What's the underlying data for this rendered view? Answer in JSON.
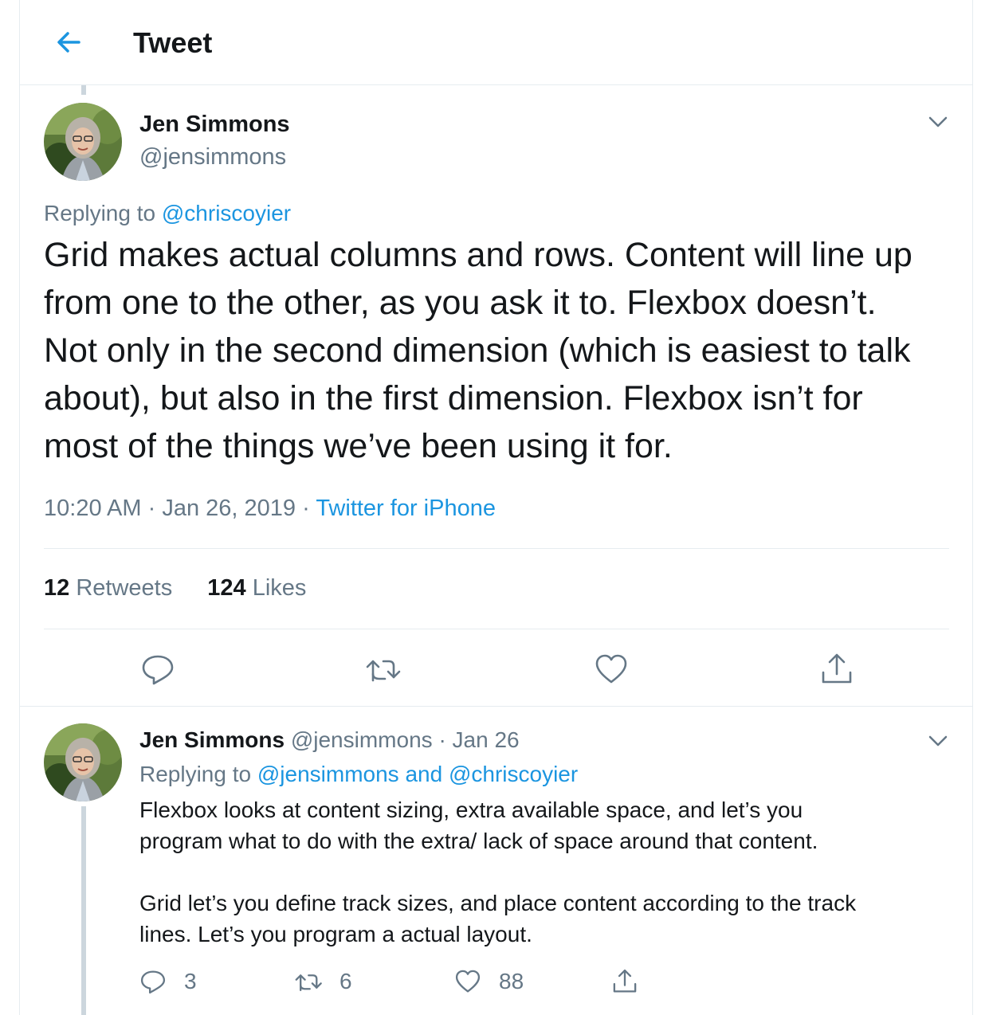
{
  "header": {
    "title": "Tweet",
    "back_icon": "arrow-left-icon"
  },
  "colors": {
    "accent": "#1b95e0",
    "text": "#14171a",
    "secondary": "#657786",
    "border": "#e6ecf0",
    "thread_line": "#ccd6dd"
  },
  "tweet": {
    "author_name": "Jen Simmons",
    "author_handle": "@jensimmons",
    "replying_label": "Replying to",
    "replying_to": "@chriscoyier",
    "lines": [
      "Grid makes actual columns and rows. Content will line up",
      "from one to the other, as you ask it to. Flexbox doesn’t.",
      "Not only in the second dimension (which is easiest to talk",
      "about), but also in the first dimension. Flexbox isn’t for",
      "most of the things we’ve been using it for."
    ],
    "time": "10:20 AM",
    "date": "Jan 26, 2019",
    "source": "Twitter for iPhone",
    "dot": "·",
    "retweets_count": "12",
    "retweets_label": "Retweets",
    "likes_count": "124",
    "likes_label": "Likes",
    "actions": [
      "reply-icon",
      "retweet-icon",
      "like-icon",
      "share-icon"
    ]
  },
  "reply": {
    "author_name": "Jen Simmons",
    "author_handle": "@jensimmons",
    "dot": "·",
    "date": "Jan 26",
    "replying_label": "Replying to",
    "replying_to": "@jensimmons and @chriscoyier",
    "paragraphs": [
      "Flexbox looks at content sizing, extra available space, and let’s you program what to do with the extra/ lack of space around that content.",
      "Grid let’s you define track sizes, and place content according to the track lines. Let’s you program a actual layout."
    ],
    "line_breaks": [
      [
        "Flexbox looks at content sizing, extra available space, and let’s you",
        "program what to do with the extra/ lack of space around that content."
      ],
      [
        "Grid let’s you define track sizes, and place content according to the track",
        "lines. Let’s you program a actual layout."
      ]
    ],
    "reply_count": "3",
    "retweet_count": "6",
    "like_count": "88"
  }
}
